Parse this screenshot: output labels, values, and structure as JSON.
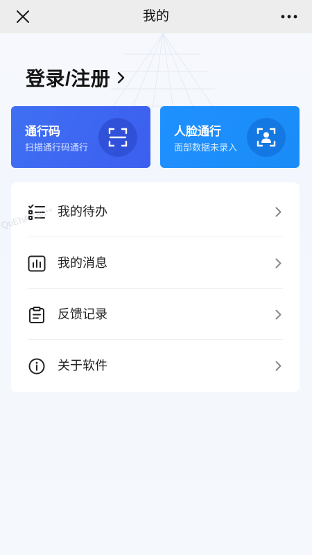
{
  "header": {
    "title": "我的",
    "close_icon": "close-icon",
    "more_icon": "more-icon"
  },
  "login": {
    "label": "登录/注册",
    "icon": "chevron-right-icon"
  },
  "cards": [
    {
      "title": "通行码",
      "subtitle": "扫描通行码通行",
      "icon": "scan-code-icon",
      "color": "#3d66f1"
    },
    {
      "title": "人脸通行",
      "subtitle": "面部数据未录入",
      "icon": "face-scan-icon",
      "color": "#1d8efc"
    }
  ],
  "menu": [
    {
      "label": "我的待办",
      "icon": "checklist-icon"
    },
    {
      "label": "我的消息",
      "icon": "message-chart-icon"
    },
    {
      "label": "反馈记录",
      "icon": "clipboard-icon"
    },
    {
      "label": "关于软件",
      "icon": "info-icon"
    }
  ],
  "watermark": "QuEhA 188**",
  "colors": {
    "topbar_bg": "#ededed",
    "page_bg": "#f5f8fd",
    "text_primary": "#222222",
    "chevron": "#888888"
  }
}
